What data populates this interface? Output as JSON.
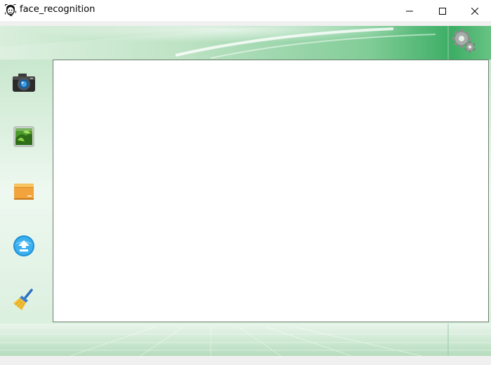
{
  "window": {
    "title": "face_recognition",
    "controls": {
      "minimize": "minimize-icon",
      "maximize": "maximize-icon",
      "close": "close-icon"
    }
  },
  "toolbar": {
    "tools": [
      {
        "id": "camera",
        "icon": "camera-icon"
      },
      {
        "id": "image",
        "icon": "image-icon"
      },
      {
        "id": "folder",
        "icon": "folder-icon"
      },
      {
        "id": "upload",
        "icon": "upload-icon"
      },
      {
        "id": "clear",
        "icon": "broom-icon"
      }
    ],
    "settings": {
      "icon": "gear-icon"
    }
  },
  "colors": {
    "accent_green": "#2fa05a",
    "panel_green": "#c9e8cf",
    "canvas": "#ffffff"
  }
}
